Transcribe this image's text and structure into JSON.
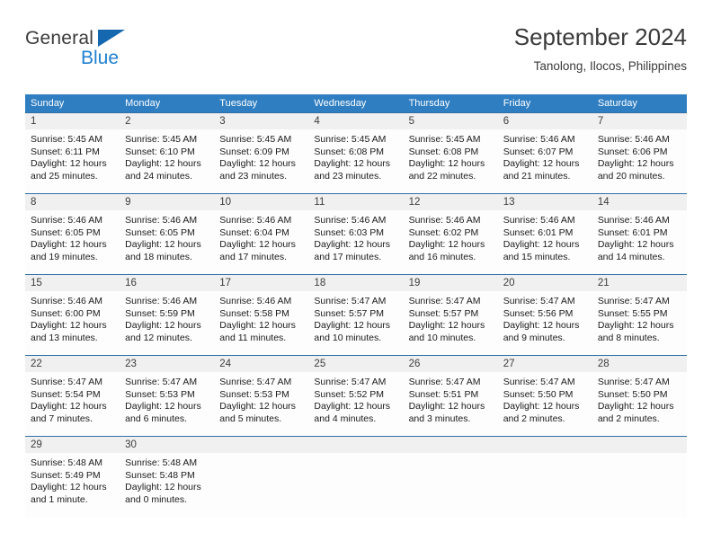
{
  "brand": {
    "name_part1": "General",
    "name_part2": "Blue",
    "logo_icon": "triangle-logo-icon"
  },
  "header": {
    "title": "September 2024",
    "location": "Tanolong, Ilocos, Philippines"
  },
  "colors": {
    "header_blue": "#2f7ec1",
    "row_border_blue": "#2f6fa8",
    "brand_blue": "#1f7fd0",
    "logo_blue": "#1568b0",
    "day_number_bg": "#f0f0f0"
  },
  "weekday_headers": [
    "Sunday",
    "Monday",
    "Tuesday",
    "Wednesday",
    "Thursday",
    "Friday",
    "Saturday"
  ],
  "weeks": [
    [
      {
        "day": "1",
        "sunrise": "Sunrise: 5:45 AM",
        "sunset": "Sunset: 6:11 PM",
        "daylight_line1": "Daylight: 12 hours",
        "daylight_line2": "and 25 minutes."
      },
      {
        "day": "2",
        "sunrise": "Sunrise: 5:45 AM",
        "sunset": "Sunset: 6:10 PM",
        "daylight_line1": "Daylight: 12 hours",
        "daylight_line2": "and 24 minutes."
      },
      {
        "day": "3",
        "sunrise": "Sunrise: 5:45 AM",
        "sunset": "Sunset: 6:09 PM",
        "daylight_line1": "Daylight: 12 hours",
        "daylight_line2": "and 23 minutes."
      },
      {
        "day": "4",
        "sunrise": "Sunrise: 5:45 AM",
        "sunset": "Sunset: 6:08 PM",
        "daylight_line1": "Daylight: 12 hours",
        "daylight_line2": "and 23 minutes."
      },
      {
        "day": "5",
        "sunrise": "Sunrise: 5:45 AM",
        "sunset": "Sunset: 6:08 PM",
        "daylight_line1": "Daylight: 12 hours",
        "daylight_line2": "and 22 minutes."
      },
      {
        "day": "6",
        "sunrise": "Sunrise: 5:46 AM",
        "sunset": "Sunset: 6:07 PM",
        "daylight_line1": "Daylight: 12 hours",
        "daylight_line2": "and 21 minutes."
      },
      {
        "day": "7",
        "sunrise": "Sunrise: 5:46 AM",
        "sunset": "Sunset: 6:06 PM",
        "daylight_line1": "Daylight: 12 hours",
        "daylight_line2": "and 20 minutes."
      }
    ],
    [
      {
        "day": "8",
        "sunrise": "Sunrise: 5:46 AM",
        "sunset": "Sunset: 6:05 PM",
        "daylight_line1": "Daylight: 12 hours",
        "daylight_line2": "and 19 minutes."
      },
      {
        "day": "9",
        "sunrise": "Sunrise: 5:46 AM",
        "sunset": "Sunset: 6:05 PM",
        "daylight_line1": "Daylight: 12 hours",
        "daylight_line2": "and 18 minutes."
      },
      {
        "day": "10",
        "sunrise": "Sunrise: 5:46 AM",
        "sunset": "Sunset: 6:04 PM",
        "daylight_line1": "Daylight: 12 hours",
        "daylight_line2": "and 17 minutes."
      },
      {
        "day": "11",
        "sunrise": "Sunrise: 5:46 AM",
        "sunset": "Sunset: 6:03 PM",
        "daylight_line1": "Daylight: 12 hours",
        "daylight_line2": "and 17 minutes."
      },
      {
        "day": "12",
        "sunrise": "Sunrise: 5:46 AM",
        "sunset": "Sunset: 6:02 PM",
        "daylight_line1": "Daylight: 12 hours",
        "daylight_line2": "and 16 minutes."
      },
      {
        "day": "13",
        "sunrise": "Sunrise: 5:46 AM",
        "sunset": "Sunset: 6:01 PM",
        "daylight_line1": "Daylight: 12 hours",
        "daylight_line2": "and 15 minutes."
      },
      {
        "day": "14",
        "sunrise": "Sunrise: 5:46 AM",
        "sunset": "Sunset: 6:01 PM",
        "daylight_line1": "Daylight: 12 hours",
        "daylight_line2": "and 14 minutes."
      }
    ],
    [
      {
        "day": "15",
        "sunrise": "Sunrise: 5:46 AM",
        "sunset": "Sunset: 6:00 PM",
        "daylight_line1": "Daylight: 12 hours",
        "daylight_line2": "and 13 minutes."
      },
      {
        "day": "16",
        "sunrise": "Sunrise: 5:46 AM",
        "sunset": "Sunset: 5:59 PM",
        "daylight_line1": "Daylight: 12 hours",
        "daylight_line2": "and 12 minutes."
      },
      {
        "day": "17",
        "sunrise": "Sunrise: 5:46 AM",
        "sunset": "Sunset: 5:58 PM",
        "daylight_line1": "Daylight: 12 hours",
        "daylight_line2": "and 11 minutes."
      },
      {
        "day": "18",
        "sunrise": "Sunrise: 5:47 AM",
        "sunset": "Sunset: 5:57 PM",
        "daylight_line1": "Daylight: 12 hours",
        "daylight_line2": "and 10 minutes."
      },
      {
        "day": "19",
        "sunrise": "Sunrise: 5:47 AM",
        "sunset": "Sunset: 5:57 PM",
        "daylight_line1": "Daylight: 12 hours",
        "daylight_line2": "and 10 minutes."
      },
      {
        "day": "20",
        "sunrise": "Sunrise: 5:47 AM",
        "sunset": "Sunset: 5:56 PM",
        "daylight_line1": "Daylight: 12 hours",
        "daylight_line2": "and 9 minutes."
      },
      {
        "day": "21",
        "sunrise": "Sunrise: 5:47 AM",
        "sunset": "Sunset: 5:55 PM",
        "daylight_line1": "Daylight: 12 hours",
        "daylight_line2": "and 8 minutes."
      }
    ],
    [
      {
        "day": "22",
        "sunrise": "Sunrise: 5:47 AM",
        "sunset": "Sunset: 5:54 PM",
        "daylight_line1": "Daylight: 12 hours",
        "daylight_line2": "and 7 minutes."
      },
      {
        "day": "23",
        "sunrise": "Sunrise: 5:47 AM",
        "sunset": "Sunset: 5:53 PM",
        "daylight_line1": "Daylight: 12 hours",
        "daylight_line2": "and 6 minutes."
      },
      {
        "day": "24",
        "sunrise": "Sunrise: 5:47 AM",
        "sunset": "Sunset: 5:53 PM",
        "daylight_line1": "Daylight: 12 hours",
        "daylight_line2": "and 5 minutes."
      },
      {
        "day": "25",
        "sunrise": "Sunrise: 5:47 AM",
        "sunset": "Sunset: 5:52 PM",
        "daylight_line1": "Daylight: 12 hours",
        "daylight_line2": "and 4 minutes."
      },
      {
        "day": "26",
        "sunrise": "Sunrise: 5:47 AM",
        "sunset": "Sunset: 5:51 PM",
        "daylight_line1": "Daylight: 12 hours",
        "daylight_line2": "and 3 minutes."
      },
      {
        "day": "27",
        "sunrise": "Sunrise: 5:47 AM",
        "sunset": "Sunset: 5:50 PM",
        "daylight_line1": "Daylight: 12 hours",
        "daylight_line2": "and 2 minutes."
      },
      {
        "day": "28",
        "sunrise": "Sunrise: 5:47 AM",
        "sunset": "Sunset: 5:50 PM",
        "daylight_line1": "Daylight: 12 hours",
        "daylight_line2": "and 2 minutes."
      }
    ],
    [
      {
        "day": "29",
        "sunrise": "Sunrise: 5:48 AM",
        "sunset": "Sunset: 5:49 PM",
        "daylight_line1": "Daylight: 12 hours",
        "daylight_line2": "and 1 minute."
      },
      {
        "day": "30",
        "sunrise": "Sunrise: 5:48 AM",
        "sunset": "Sunset: 5:48 PM",
        "daylight_line1": "Daylight: 12 hours",
        "daylight_line2": "and 0 minutes."
      },
      {
        "day": "",
        "sunrise": "",
        "sunset": "",
        "daylight_line1": "",
        "daylight_line2": ""
      },
      {
        "day": "",
        "sunrise": "",
        "sunset": "",
        "daylight_line1": "",
        "daylight_line2": ""
      },
      {
        "day": "",
        "sunrise": "",
        "sunset": "",
        "daylight_line1": "",
        "daylight_line2": ""
      },
      {
        "day": "",
        "sunrise": "",
        "sunset": "",
        "daylight_line1": "",
        "daylight_line2": ""
      },
      {
        "day": "",
        "sunrise": "",
        "sunset": "",
        "daylight_line1": "",
        "daylight_line2": ""
      }
    ]
  ]
}
